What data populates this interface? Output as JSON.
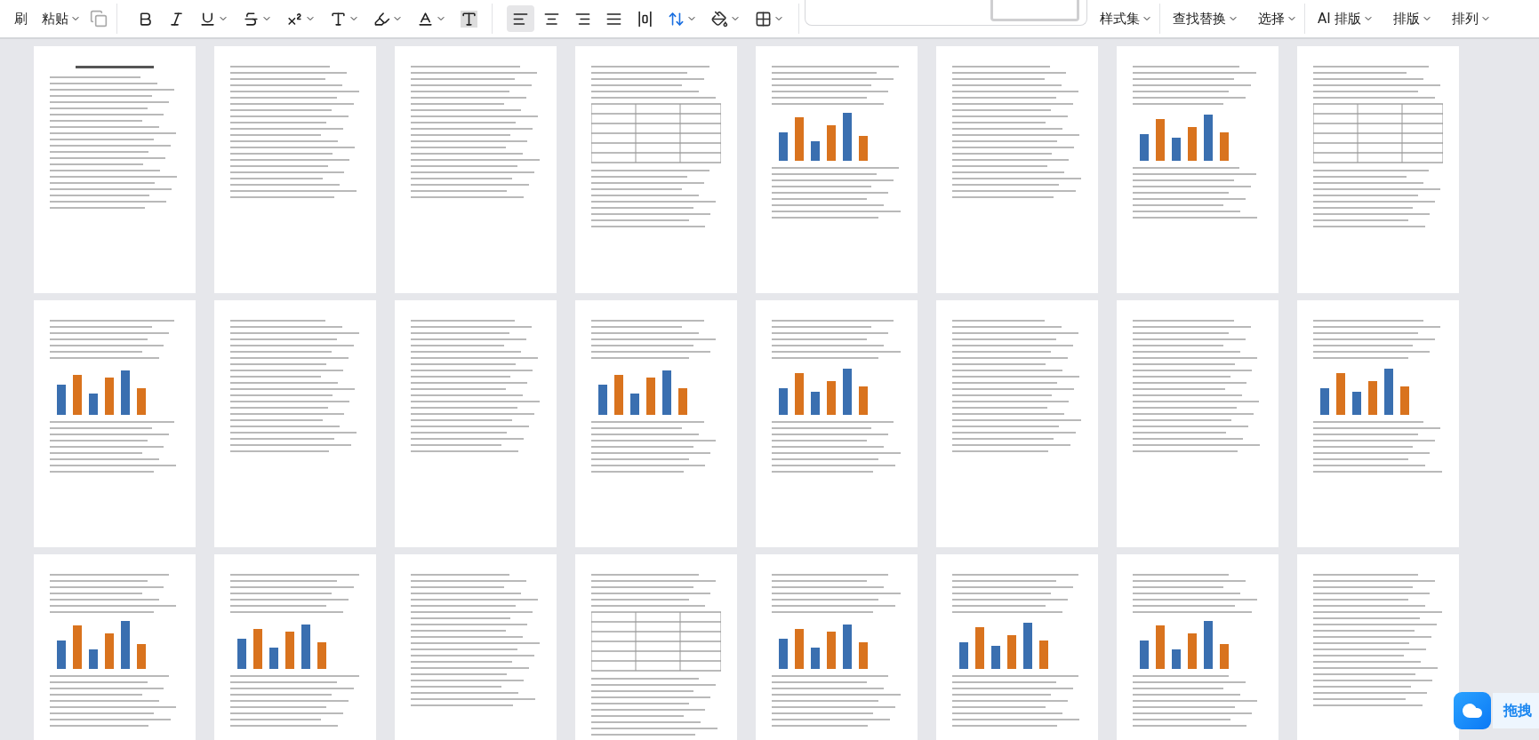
{
  "toolbar": {
    "clipboard": [
      {
        "label": "刷",
        "dropdown": false
      },
      {
        "label": "粘贴",
        "dropdown": true
      }
    ],
    "format": [
      {
        "kind": "bold",
        "dropdown": false
      },
      {
        "kind": "italic",
        "dropdown": false
      },
      {
        "kind": "underline",
        "dropdown": true
      },
      {
        "kind": "strike",
        "dropdown": true
      },
      {
        "kind": "superscript",
        "dropdown": true
      },
      {
        "kind": "effect",
        "dropdown": true
      },
      {
        "kind": "highlight",
        "dropdown": true
      },
      {
        "kind": "fontcolor",
        "dropdown": true
      },
      {
        "kind": "shading",
        "dropdown": false
      }
    ],
    "alignment": [
      {
        "kind": "left",
        "selected": true
      },
      {
        "kind": "center",
        "selected": false
      },
      {
        "kind": "right",
        "selected": false
      },
      {
        "kind": "justify",
        "selected": false
      },
      {
        "kind": "distributed",
        "selected": false
      }
    ],
    "paragraph": [
      {
        "kind": "spacing",
        "dropdown": true
      },
      {
        "kind": "fill",
        "dropdown": true
      },
      {
        "kind": "border",
        "dropdown": true
      }
    ],
    "menus": [
      {
        "label": "样式集",
        "dropdown": true
      },
      {
        "label": "查找替换",
        "dropdown": true
      },
      {
        "label": "选择",
        "dropdown": true
      },
      {
        "label": "AI 排版",
        "dropdown": true
      },
      {
        "label": "排版",
        "dropdown": true
      },
      {
        "label": "排列",
        "dropdown": true
      }
    ]
  },
  "pages": [
    {
      "kind": "text"
    },
    {
      "kind": "text"
    },
    {
      "kind": "text"
    },
    {
      "kind": "table"
    },
    {
      "kind": "chart"
    },
    {
      "kind": "text"
    },
    {
      "kind": "chart"
    },
    {
      "kind": "table"
    },
    {
      "kind": "chart"
    },
    {
      "kind": "text"
    },
    {
      "kind": "text"
    },
    {
      "kind": "chart"
    },
    {
      "kind": "chart"
    },
    {
      "kind": "text"
    },
    {
      "kind": "text"
    },
    {
      "kind": "chart"
    },
    {
      "kind": "chart"
    },
    {
      "kind": "chart"
    },
    {
      "kind": "text"
    },
    {
      "kind": "table"
    },
    {
      "kind": "chart"
    },
    {
      "kind": "chart"
    },
    {
      "kind": "chart"
    },
    {
      "kind": "text"
    }
  ],
  "float_button": {
    "label": "拖拽"
  }
}
